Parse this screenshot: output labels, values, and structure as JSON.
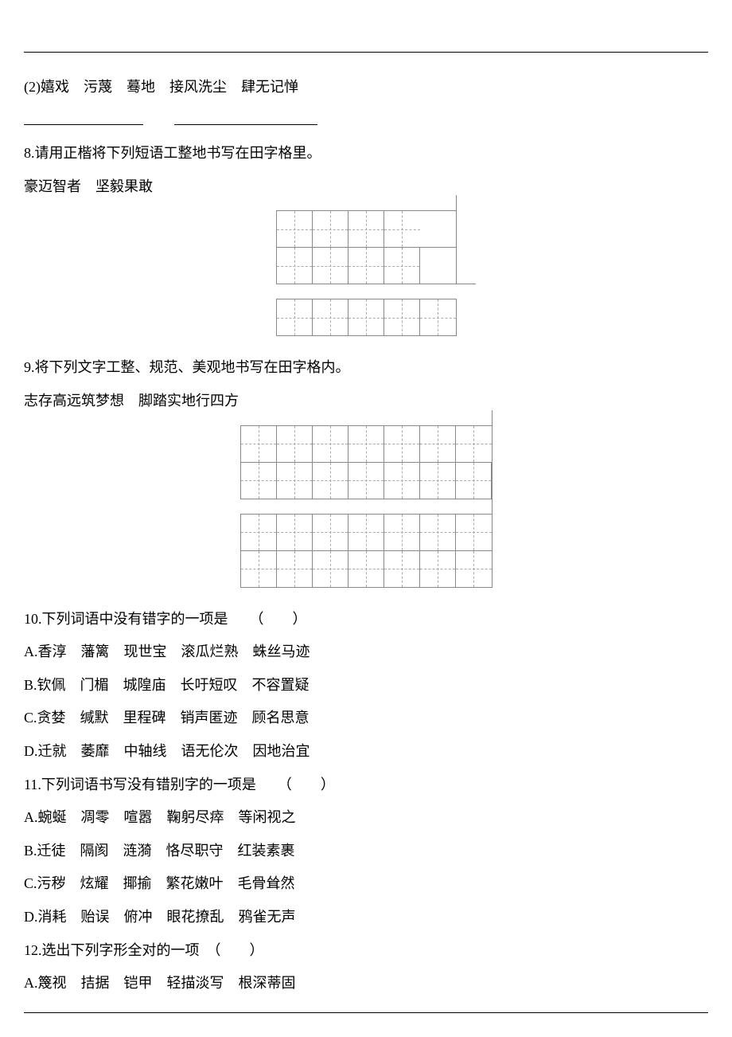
{
  "q_sub": "(2)嬉戏　污蔑　蓦地　接风洗尘　肆无记惮",
  "q8_prompt": "8.请用正楷将下列短语工整地书写在田字格里。",
  "q8_phrases": "豪迈智者　坚毅果敢",
  "q9_prompt": "9.将下列文字工整、规范、美观地书写在田字格内。",
  "q9_phrases": "志存高远筑梦想　脚踏实地行四方",
  "q10_prompt": "10.下列词语中没有错字的一项是　　（　　）",
  "q10_a": "A.香淳　藩篱　现世宝　滚瓜烂熟　蛛丝马迹",
  "q10_b": "B.钦佩　门楣　城隍庙　长吁短叹　不容置疑",
  "q10_c": "C.贪婪　缄默　里程碑　销声匿迹　顾名思意",
  "q10_d": "D.迁就　萎靡　中轴线　语无伦次　因地治宜",
  "q11_prompt": "11.下列词语书写没有错别字的一项是　　（　　）",
  "q11_a": "A.蜿蜒　凋零　喧嚣　鞠躬尽瘁　等闲视之",
  "q11_b": "B.迁徒　隔阂　涟漪　恪尽职守　红装素裹",
  "q11_c": "C.污秽　炫耀　揶揄　繁花嫩叶　毛骨耸然",
  "q11_d": "D.消耗　贻误　俯冲　眼花撩乱　鸦雀无声",
  "q12_prompt": "12.选出下列字形全对的一项　（　　）",
  "q12_a": "A.篾视　拮据　铠甲　轻描淡写　根深蒂固"
}
